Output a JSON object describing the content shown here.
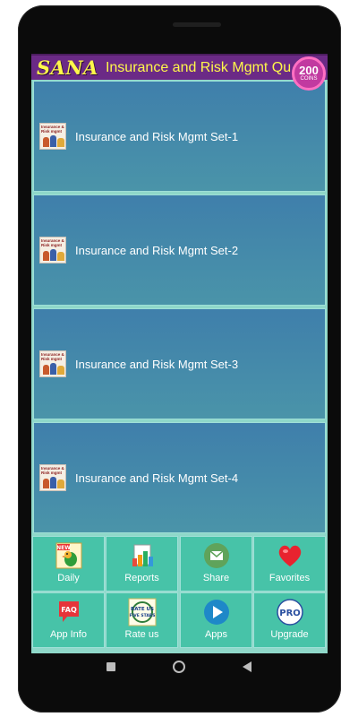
{
  "header": {
    "brand": "SANA",
    "title": "Insurance and Risk Mgmt Qu",
    "coins": {
      "value": "200",
      "label": "COINS"
    },
    "colors": {
      "bar": "#6b2a86",
      "text": "#fff84a"
    }
  },
  "sets": [
    {
      "label": "Insurance and Risk Mgmt Set-1",
      "thumb_text": "Insurance & Risk mgmt"
    },
    {
      "label": "Insurance and Risk Mgmt Set-2",
      "thumb_text": "Insurance & Risk mgmt"
    },
    {
      "label": "Insurance and Risk Mgmt Set-3",
      "thumb_text": "Insurance & Risk mgmt"
    },
    {
      "label": "Insurance and Risk Mgmt Set-4",
      "thumb_text": "Insurance & Risk mgmt"
    }
  ],
  "menu": [
    {
      "label": "Daily",
      "icon": "new-bird-icon"
    },
    {
      "label": "Reports",
      "icon": "chart-report-icon"
    },
    {
      "label": "Share",
      "icon": "envelope-icon"
    },
    {
      "label": "Favorites",
      "icon": "heart-icon"
    },
    {
      "label": "App Info",
      "icon": "faq-bubble-icon"
    },
    {
      "label": "Rate us",
      "icon": "rate-us-badge-icon",
      "badge_text": "RATE US FIVE STARS"
    },
    {
      "label": "Apps",
      "icon": "play-store-icon"
    },
    {
      "label": "Upgrade",
      "icon": "pro-badge-icon",
      "badge_text": "PRO"
    }
  ],
  "new_badge": "NEW",
  "faq_badge": "FAQ"
}
